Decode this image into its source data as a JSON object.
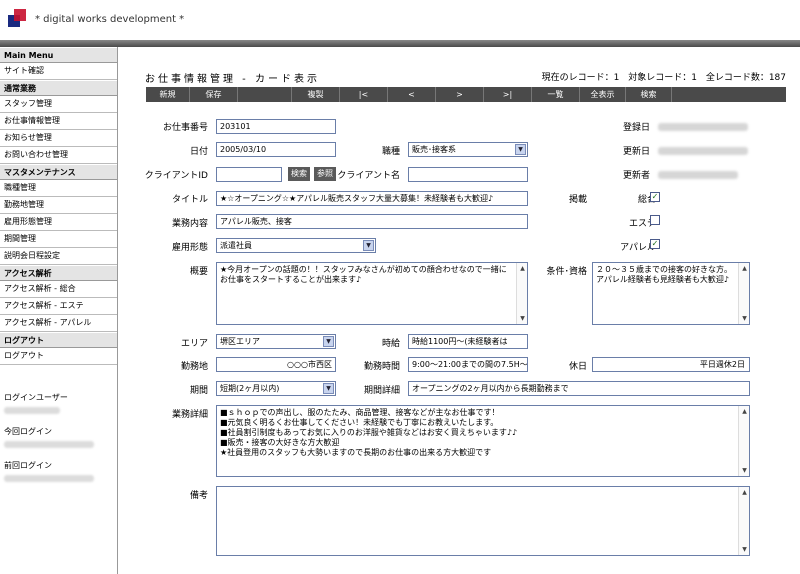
{
  "header": {
    "brand": "* digital works development *"
  },
  "sidebar": {
    "main_menu": "Main Menu",
    "site_check": "サイト確認",
    "daily": "通常業務",
    "daily_items": [
      "スタッフ管理",
      "お仕事情報管理",
      "お知らせ管理",
      "お問い合わせ管理"
    ],
    "master": "マスタメンテナンス",
    "master_items": [
      "職種管理",
      "勤務地管理",
      "雇用形態管理",
      "期間管理",
      "説明会日程設定"
    ],
    "access": "アクセス解析",
    "access_items": [
      "アクセス解析 - 総合",
      "アクセス解析 - エステ",
      "アクセス解析 - アパレル"
    ],
    "logout": "ログアウト",
    "logout_item": "ログアウト",
    "login_user": "ログインユーザー",
    "this_login": "今回ログイン",
    "last_login": "前回ログイン"
  },
  "page": {
    "title": "お仕事情報管理 - カード表示",
    "current_record": "現在のレコード：1",
    "target_record": "対象レコード：1",
    "total_record": "全レコード数：187"
  },
  "toolbar": [
    "新規",
    "保存",
    "",
    "複製",
    "|<",
    "<",
    ">",
    ">|",
    "一覧",
    "全表示",
    "検索",
    ""
  ],
  "form": {
    "job_no_label": "お仕事番号",
    "job_no": "203101",
    "date_label": "日付",
    "date": "2005/03/10",
    "category_label": "職種",
    "category": "販売･接客系",
    "client_id_label": "クライアントID",
    "client_id": "",
    "search_btn": "検索",
    "ref_btn": "参照",
    "client_name_label": "クライアント名",
    "client_name": "",
    "title_label": "タイトル",
    "title": "★☆オープニング☆★アパレル販売スタッフ大量大募集！未経験者も大歓迎♪",
    "business_label": "業務内容",
    "business": "アパレル販売、接客",
    "employment_label": "雇用形態",
    "employment": "派遣社員",
    "overview_label": "概要",
    "overview": "★今月オープンの話題の！！スタッフみなさんが初めての顔合わせなので一緒にお仕事をスタートすることが出来ます♪",
    "conditions_label": "条件･資格",
    "conditions": "２０～３５歳までの接客の好きな方。アパレル経験者も見経験者も大歓迎♪",
    "area_label": "エリア",
    "area": "堺区エリア",
    "wage_label": "時給",
    "wage": "時給1100円～(未経験者は",
    "location_label": "勤務地",
    "location": "○○○市西区",
    "hours_label": "勤務時間",
    "hours": "9:00～21:00までの間の7.5H～",
    "holiday_label": "休日",
    "holiday": "平日週休2日",
    "period_label": "期間",
    "period": "短期(2ヶ月以内)",
    "period_detail_label": "期間詳細",
    "period_detail": "オープニングの2ヶ月以内から長期勤務まで",
    "details_label": "業務詳細",
    "details": [
      "■ｓｈｏｐでの声出し、服のたたみ、商品管理、接客などが主なお仕事です！",
      "■元気良く明るくお仕事してください！未経験でも丁寧にお教えいたします。",
      "■社員割引制度もあってお気に入りのお洋服や雑貨などはお安く買えちゃいます♪♪",
      "■販売・接客の大好きな方大歓迎",
      "★社員登用のスタッフも大勢いますので長期のお仕事の出来る方大歓迎です"
    ],
    "notes_label": "備考",
    "notes": "",
    "registered_label": "登録日",
    "updated_label": "更新日",
    "updater_label": "更新者",
    "publish_label": "掲載",
    "general_label": "総合",
    "general_checked": true,
    "esthe_label": "エステ",
    "esthe_checked": false,
    "apparel_label": "アパレル",
    "apparel_checked": true
  },
  "colors": {
    "toolbar_bg": "#4a4a4a",
    "field_border": "#6a7ea8",
    "check_color": "#1c6e1c"
  }
}
